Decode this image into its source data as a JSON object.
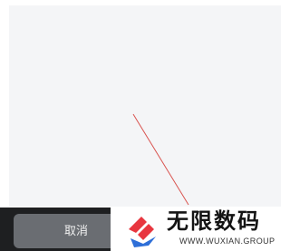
{
  "footer": {
    "cancel_label": "取消"
  },
  "watermark": {
    "title": "无限数码",
    "subtitle": "WWW.WUXIAN.GROUP",
    "logo_colors": {
      "red": "#e8363f",
      "blue": "#2e6fd8"
    }
  },
  "annotation": {
    "color": "#d9534f"
  },
  "colors": {
    "panel": "#f4f5f7",
    "bar": "#1e1f21",
    "button": "#6a6d72"
  }
}
